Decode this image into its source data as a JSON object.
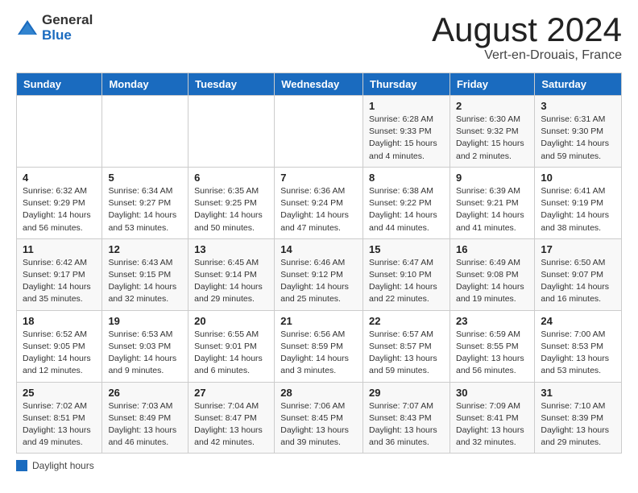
{
  "header": {
    "logo_general": "General",
    "logo_blue": "Blue",
    "month_year": "August 2024",
    "location": "Vert-en-Drouais, France"
  },
  "legend": {
    "box_label": "Daylight hours"
  },
  "days_of_week": [
    "Sunday",
    "Monday",
    "Tuesday",
    "Wednesday",
    "Thursday",
    "Friday",
    "Saturday"
  ],
  "weeks": [
    [
      {
        "day": "",
        "info": ""
      },
      {
        "day": "",
        "info": ""
      },
      {
        "day": "",
        "info": ""
      },
      {
        "day": "",
        "info": ""
      },
      {
        "day": "1",
        "info": "Sunrise: 6:28 AM\nSunset: 9:33 PM\nDaylight: 15 hours\nand 4 minutes."
      },
      {
        "day": "2",
        "info": "Sunrise: 6:30 AM\nSunset: 9:32 PM\nDaylight: 15 hours\nand 2 minutes."
      },
      {
        "day": "3",
        "info": "Sunrise: 6:31 AM\nSunset: 9:30 PM\nDaylight: 14 hours\nand 59 minutes."
      }
    ],
    [
      {
        "day": "4",
        "info": "Sunrise: 6:32 AM\nSunset: 9:29 PM\nDaylight: 14 hours\nand 56 minutes."
      },
      {
        "day": "5",
        "info": "Sunrise: 6:34 AM\nSunset: 9:27 PM\nDaylight: 14 hours\nand 53 minutes."
      },
      {
        "day": "6",
        "info": "Sunrise: 6:35 AM\nSunset: 9:25 PM\nDaylight: 14 hours\nand 50 minutes."
      },
      {
        "day": "7",
        "info": "Sunrise: 6:36 AM\nSunset: 9:24 PM\nDaylight: 14 hours\nand 47 minutes."
      },
      {
        "day": "8",
        "info": "Sunrise: 6:38 AM\nSunset: 9:22 PM\nDaylight: 14 hours\nand 44 minutes."
      },
      {
        "day": "9",
        "info": "Sunrise: 6:39 AM\nSunset: 9:21 PM\nDaylight: 14 hours\nand 41 minutes."
      },
      {
        "day": "10",
        "info": "Sunrise: 6:41 AM\nSunset: 9:19 PM\nDaylight: 14 hours\nand 38 minutes."
      }
    ],
    [
      {
        "day": "11",
        "info": "Sunrise: 6:42 AM\nSunset: 9:17 PM\nDaylight: 14 hours\nand 35 minutes."
      },
      {
        "day": "12",
        "info": "Sunrise: 6:43 AM\nSunset: 9:15 PM\nDaylight: 14 hours\nand 32 minutes."
      },
      {
        "day": "13",
        "info": "Sunrise: 6:45 AM\nSunset: 9:14 PM\nDaylight: 14 hours\nand 29 minutes."
      },
      {
        "day": "14",
        "info": "Sunrise: 6:46 AM\nSunset: 9:12 PM\nDaylight: 14 hours\nand 25 minutes."
      },
      {
        "day": "15",
        "info": "Sunrise: 6:47 AM\nSunset: 9:10 PM\nDaylight: 14 hours\nand 22 minutes."
      },
      {
        "day": "16",
        "info": "Sunrise: 6:49 AM\nSunset: 9:08 PM\nDaylight: 14 hours\nand 19 minutes."
      },
      {
        "day": "17",
        "info": "Sunrise: 6:50 AM\nSunset: 9:07 PM\nDaylight: 14 hours\nand 16 minutes."
      }
    ],
    [
      {
        "day": "18",
        "info": "Sunrise: 6:52 AM\nSunset: 9:05 PM\nDaylight: 14 hours\nand 12 minutes."
      },
      {
        "day": "19",
        "info": "Sunrise: 6:53 AM\nSunset: 9:03 PM\nDaylight: 14 hours\nand 9 minutes."
      },
      {
        "day": "20",
        "info": "Sunrise: 6:55 AM\nSunset: 9:01 PM\nDaylight: 14 hours\nand 6 minutes."
      },
      {
        "day": "21",
        "info": "Sunrise: 6:56 AM\nSunset: 8:59 PM\nDaylight: 14 hours\nand 3 minutes."
      },
      {
        "day": "22",
        "info": "Sunrise: 6:57 AM\nSunset: 8:57 PM\nDaylight: 13 hours\nand 59 minutes."
      },
      {
        "day": "23",
        "info": "Sunrise: 6:59 AM\nSunset: 8:55 PM\nDaylight: 13 hours\nand 56 minutes."
      },
      {
        "day": "24",
        "info": "Sunrise: 7:00 AM\nSunset: 8:53 PM\nDaylight: 13 hours\nand 53 minutes."
      }
    ],
    [
      {
        "day": "25",
        "info": "Sunrise: 7:02 AM\nSunset: 8:51 PM\nDaylight: 13 hours\nand 49 minutes."
      },
      {
        "day": "26",
        "info": "Sunrise: 7:03 AM\nSunset: 8:49 PM\nDaylight: 13 hours\nand 46 minutes."
      },
      {
        "day": "27",
        "info": "Sunrise: 7:04 AM\nSunset: 8:47 PM\nDaylight: 13 hours\nand 42 minutes."
      },
      {
        "day": "28",
        "info": "Sunrise: 7:06 AM\nSunset: 8:45 PM\nDaylight: 13 hours\nand 39 minutes."
      },
      {
        "day": "29",
        "info": "Sunrise: 7:07 AM\nSunset: 8:43 PM\nDaylight: 13 hours\nand 36 minutes."
      },
      {
        "day": "30",
        "info": "Sunrise: 7:09 AM\nSunset: 8:41 PM\nDaylight: 13 hours\nand 32 minutes."
      },
      {
        "day": "31",
        "info": "Sunrise: 7:10 AM\nSunset: 8:39 PM\nDaylight: 13 hours\nand 29 minutes."
      }
    ]
  ]
}
